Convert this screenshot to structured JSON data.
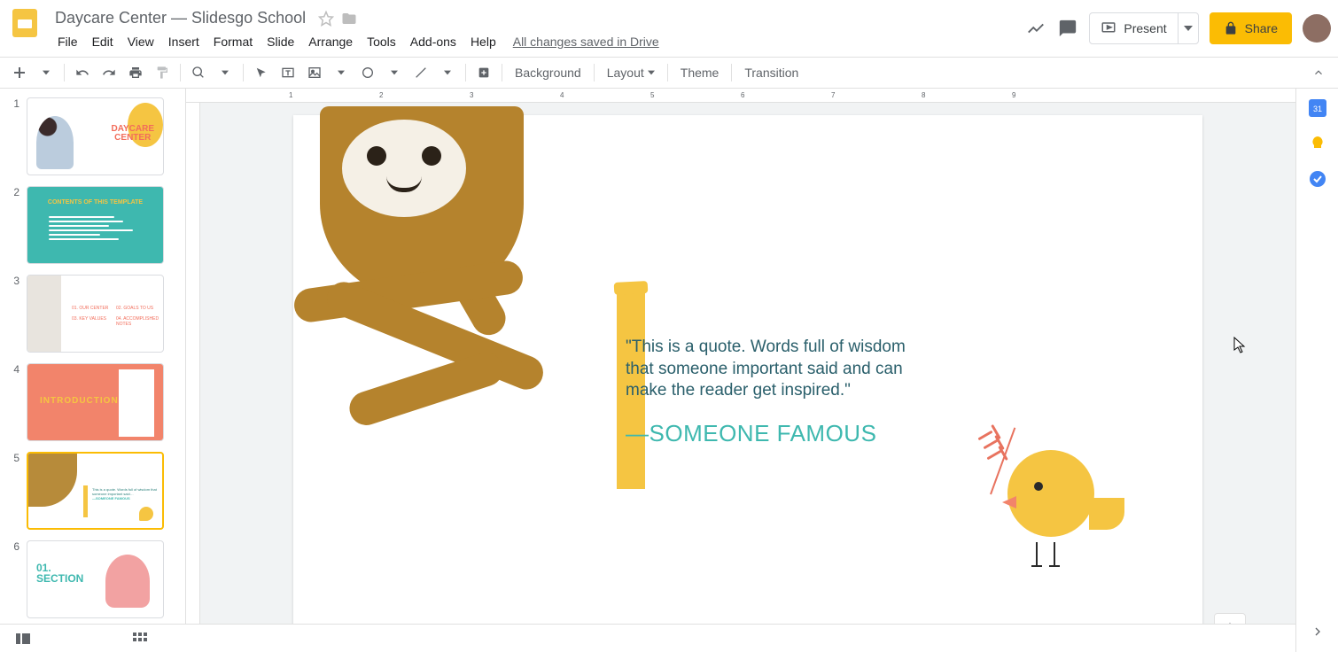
{
  "doc": {
    "title": "Daycare Center — Slidesgo School",
    "save_status": "All changes saved in Drive"
  },
  "menu": {
    "file": "File",
    "edit": "Edit",
    "view": "View",
    "insert": "Insert",
    "format": "Format",
    "slide": "Slide",
    "arrange": "Arrange",
    "tools": "Tools",
    "addons": "Add-ons",
    "help": "Help"
  },
  "header": {
    "present": "Present",
    "share": "Share"
  },
  "toolbar": {
    "background": "Background",
    "layout": "Layout",
    "theme": "Theme",
    "transition": "Transition"
  },
  "ruler": {
    "ticks": [
      "1",
      "2",
      "3",
      "4",
      "5",
      "6",
      "7",
      "8",
      "9"
    ]
  },
  "slides": {
    "s1": {
      "num": "1",
      "title1": "DAYCARE",
      "title2": "CENTER"
    },
    "s2": {
      "num": "2",
      "title": "CONTENTS OF THIS TEMPLATE"
    },
    "s3": {
      "num": "3",
      "l1": "01. OUR CENTER",
      "l2": "02. GOALS TO US",
      "l3": "03. KEY VALUES",
      "l4": "04. ACCOMPLISHED NOTES"
    },
    "s4": {
      "num": "4",
      "title": "INTRODUCTION"
    },
    "s5": {
      "num": "5",
      "quote_thumb": "This is a quote. Words full of wisdom that someone important said…",
      "author_thumb": "—SOMEONE FAMOUS"
    },
    "s6": {
      "num": "6",
      "title1": "01.",
      "title2": "SECTION"
    }
  },
  "slide5": {
    "quote": "\"This is a quote. Words full of wisdom that someone important said and can make the reader get inspired.\"",
    "author": "—SOMEONE FAMOUS"
  }
}
